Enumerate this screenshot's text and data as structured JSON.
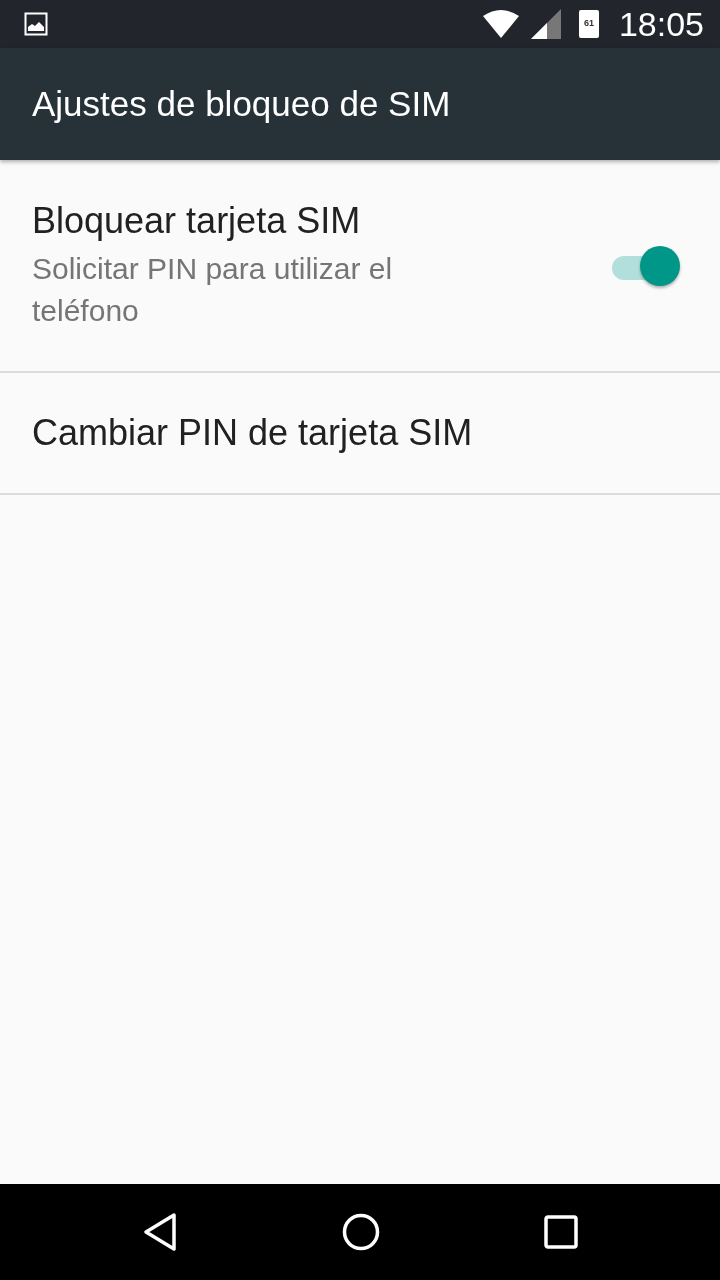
{
  "status_bar": {
    "battery": "61",
    "time": "18:05"
  },
  "app_bar": {
    "title": "Ajustes de bloqueo de SIM"
  },
  "settings": [
    {
      "kind": "switch",
      "title": "Bloquear tarjeta SIM",
      "summary": "Solicitar PIN para utilizar el teléfono",
      "on": true
    },
    {
      "kind": "plain",
      "title": "Cambiar PIN de tarjeta SIM"
    }
  ]
}
